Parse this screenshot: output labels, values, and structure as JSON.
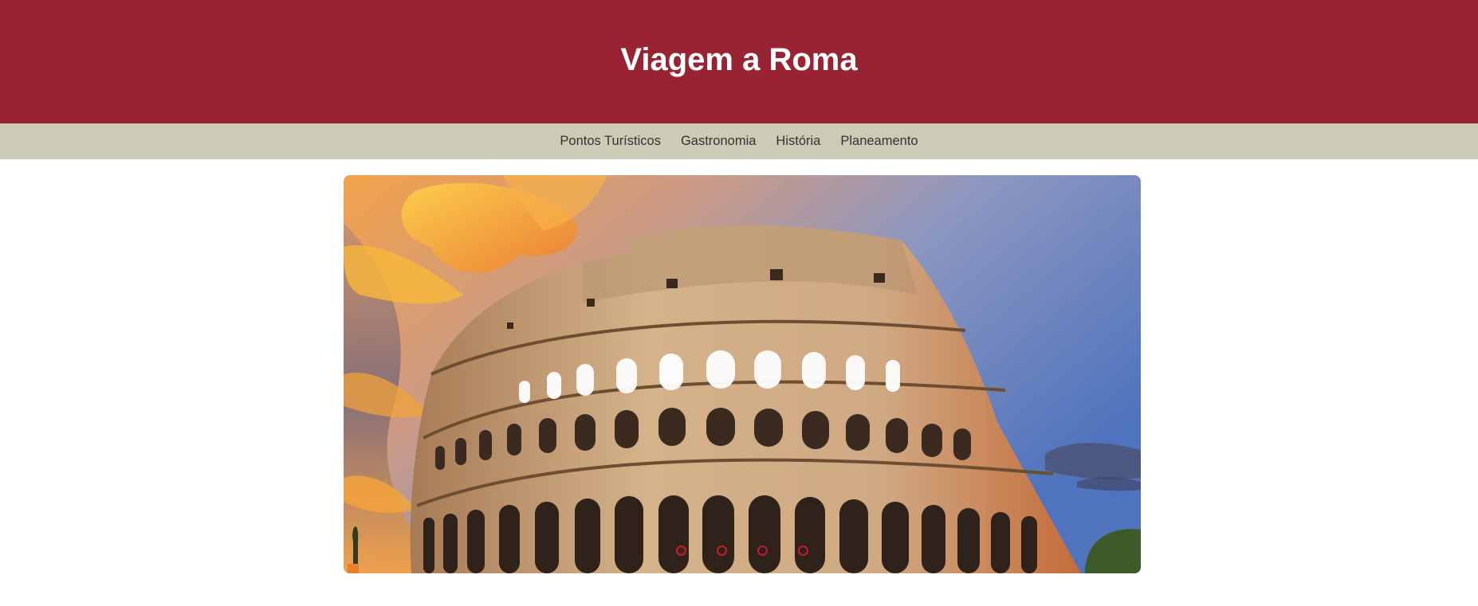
{
  "header": {
    "title": "Viagem a Roma"
  },
  "nav": {
    "items": [
      {
        "label": "Pontos Turísticos"
      },
      {
        "label": "Gastronomia"
      },
      {
        "label": "História"
      },
      {
        "label": "Planeamento"
      }
    ]
  },
  "hero": {
    "image": "colosseum-photo",
    "slide_count": 4,
    "active_slide": 1
  },
  "colors": {
    "header_bg": "#982333",
    "nav_bg": "#cbcbb8",
    "accent": "#c0202e"
  }
}
